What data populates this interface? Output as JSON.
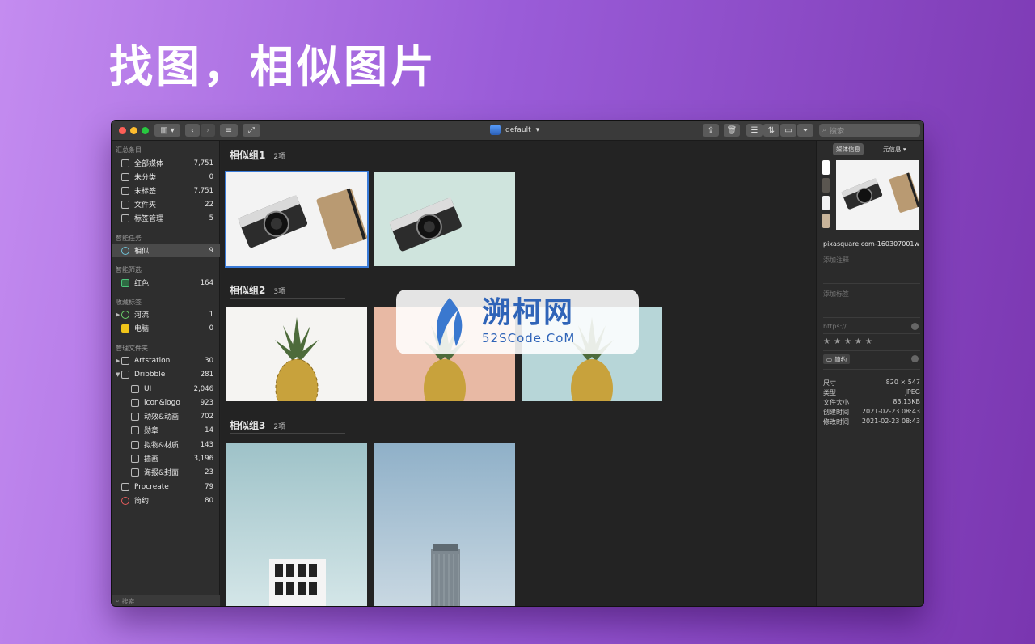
{
  "hero": {
    "title": "找图，相似图片"
  },
  "titlebar": {
    "library_name": "default",
    "search_placeholder": "搜索"
  },
  "sidebar": {
    "sections": {
      "summary": "汇总条目",
      "smart_tasks": "智能任务",
      "smart_filters": "智能筛选",
      "fav_tags": "收藏标签",
      "manage_folders": "管理文件夹"
    },
    "items": [
      {
        "label": "全部媒体",
        "count": "7,751"
      },
      {
        "label": "未分类",
        "count": "0"
      },
      {
        "label": "未标签",
        "count": "7,751"
      },
      {
        "label": "文件夹",
        "count": "22"
      },
      {
        "label": "标签管理",
        "count": "5"
      },
      {
        "label": "相似",
        "count": "9"
      },
      {
        "label": "红色",
        "count": "164"
      },
      {
        "label": "河流",
        "count": "1"
      },
      {
        "label": "电脑",
        "count": "0"
      },
      {
        "label": "Artstation",
        "count": "30"
      },
      {
        "label": "Dribbble",
        "count": "281"
      },
      {
        "label": "UI",
        "count": "2,046"
      },
      {
        "label": "icon&logo",
        "count": "923"
      },
      {
        "label": "动效&动画",
        "count": "702"
      },
      {
        "label": "勋章",
        "count": "14"
      },
      {
        "label": "拟物&材质",
        "count": "143"
      },
      {
        "label": "插画",
        "count": "3,196"
      },
      {
        "label": "海报&封面",
        "count": "23"
      },
      {
        "label": "Procreate",
        "count": "79"
      },
      {
        "label": "简约",
        "count": "80"
      }
    ],
    "search_placeholder": "搜索"
  },
  "main": {
    "groups": [
      {
        "title": "相似组1",
        "count": "2项"
      },
      {
        "title": "相似组2",
        "count": "3项"
      },
      {
        "title": "相似组3",
        "count": "2项"
      }
    ]
  },
  "inspector": {
    "tab_media": "媒体信息",
    "tab_meta": "元信息",
    "filename": "pixasquare.com-160307001w",
    "note_placeholder": "添加注释",
    "tag_placeholder": "添加标签",
    "url_placeholder": "https://",
    "rating": 0,
    "folder_tag": "简约",
    "props": [
      {
        "key": "尺寸",
        "value": "820 × 547"
      },
      {
        "key": "类型",
        "value": "JPEG"
      },
      {
        "key": "文件大小",
        "value": "83.13KB"
      },
      {
        "key": "创建时间",
        "value": "2021-02-23 08:43"
      },
      {
        "key": "修改时间",
        "value": "2021-02-23 08:43"
      }
    ],
    "swatches": [
      "#ffffff",
      "#5a5650",
      "#f4f4f4",
      "#c8b49a"
    ]
  },
  "watermark": {
    "main": "溯柯网",
    "sub": "52SCode.CoM"
  }
}
